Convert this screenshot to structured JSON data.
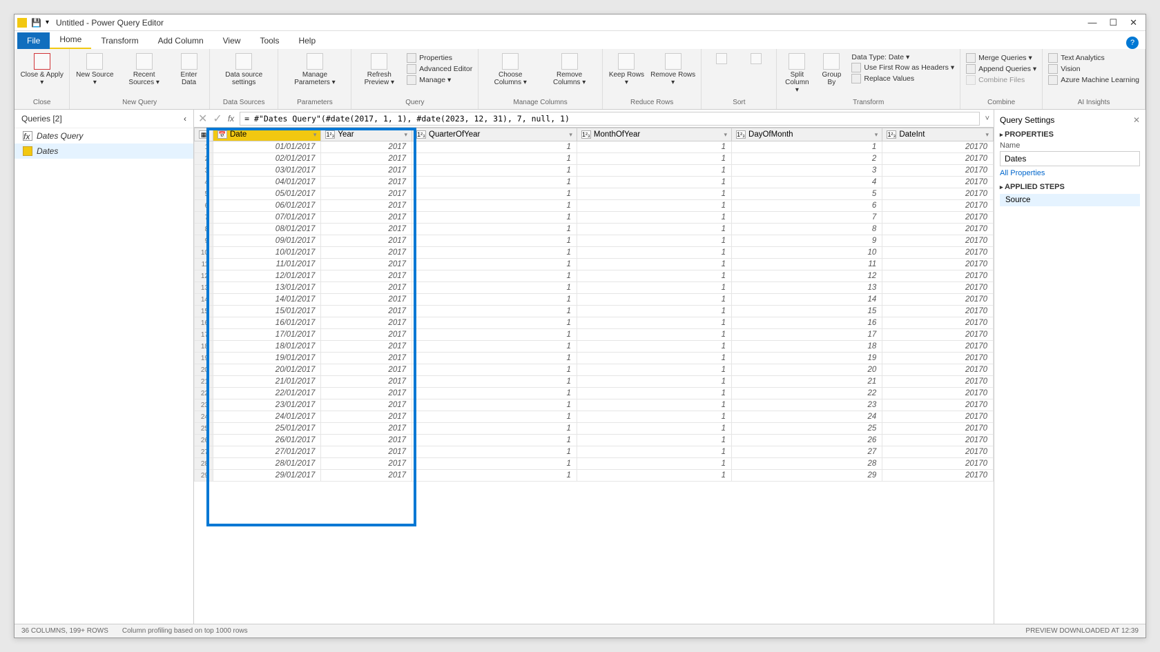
{
  "window": {
    "title": "Untitled - Power Query Editor"
  },
  "menubar": {
    "file": "File",
    "home": "Home",
    "transform": "Transform",
    "addcol": "Add Column",
    "view": "View",
    "tools": "Tools",
    "help": "Help"
  },
  "ribbon": {
    "close": {
      "closeApply": "Close &\nApply ▾",
      "group": "Close"
    },
    "newquery": {
      "newSource": "New\nSource ▾",
      "recentSources": "Recent\nSources ▾",
      "enterData": "Enter\nData",
      "group": "New Query"
    },
    "datasources": {
      "dsSettings": "Data source\nsettings",
      "group": "Data Sources"
    },
    "parameters": {
      "manage": "Manage\nParameters ▾",
      "group": "Parameters"
    },
    "query": {
      "refresh": "Refresh\nPreview ▾",
      "properties": "Properties",
      "advEditor": "Advanced Editor",
      "manage": "Manage ▾",
      "group": "Query"
    },
    "managecols": {
      "choose": "Choose\nColumns ▾",
      "remove": "Remove\nColumns ▾",
      "group": "Manage Columns"
    },
    "reducerows": {
      "keep": "Keep\nRows ▾",
      "removeR": "Remove\nRows ▾",
      "group": "Reduce Rows"
    },
    "sort": {
      "group": "Sort"
    },
    "transform": {
      "split": "Split\nColumn ▾",
      "groupby": "Group\nBy",
      "datatype": "Data Type: Date ▾",
      "firstrow": "Use First Row as Headers ▾",
      "replace": "Replace Values",
      "group": "Transform"
    },
    "combine": {
      "merge": "Merge Queries ▾",
      "append": "Append Queries ▾",
      "combinefiles": "Combine Files",
      "group": "Combine"
    },
    "ai": {
      "textan": "Text Analytics",
      "vision": "Vision",
      "azml": "Azure Machine Learning",
      "group": "AI Insights"
    }
  },
  "queries": {
    "header": "Queries [2]",
    "items": [
      "Dates Query",
      "Dates"
    ]
  },
  "formula": "= #\"Dates Query\"(#date(2017, 1, 1), #date(2023, 12, 31), 7, null, 1)",
  "columns": [
    "Date",
    "Year",
    "QuarterOfYear",
    "MonthOfYear",
    "DayOfMonth",
    "DateInt"
  ],
  "rows": [
    {
      "n": 1,
      "date": "01/01/2017",
      "year": 2017,
      "q": 1,
      "m": 1,
      "d": 1,
      "di": "20170"
    },
    {
      "n": 2,
      "date": "02/01/2017",
      "year": 2017,
      "q": 1,
      "m": 1,
      "d": 2,
      "di": "20170"
    },
    {
      "n": 3,
      "date": "03/01/2017",
      "year": 2017,
      "q": 1,
      "m": 1,
      "d": 3,
      "di": "20170"
    },
    {
      "n": 4,
      "date": "04/01/2017",
      "year": 2017,
      "q": 1,
      "m": 1,
      "d": 4,
      "di": "20170"
    },
    {
      "n": 5,
      "date": "05/01/2017",
      "year": 2017,
      "q": 1,
      "m": 1,
      "d": 5,
      "di": "20170"
    },
    {
      "n": 6,
      "date": "06/01/2017",
      "year": 2017,
      "q": 1,
      "m": 1,
      "d": 6,
      "di": "20170"
    },
    {
      "n": 7,
      "date": "07/01/2017",
      "year": 2017,
      "q": 1,
      "m": 1,
      "d": 7,
      "di": "20170"
    },
    {
      "n": 8,
      "date": "08/01/2017",
      "year": 2017,
      "q": 1,
      "m": 1,
      "d": 8,
      "di": "20170"
    },
    {
      "n": 9,
      "date": "09/01/2017",
      "year": 2017,
      "q": 1,
      "m": 1,
      "d": 9,
      "di": "20170"
    },
    {
      "n": 10,
      "date": "10/01/2017",
      "year": 2017,
      "q": 1,
      "m": 1,
      "d": 10,
      "di": "20170"
    },
    {
      "n": 11,
      "date": "11/01/2017",
      "year": 2017,
      "q": 1,
      "m": 1,
      "d": 11,
      "di": "20170"
    },
    {
      "n": 12,
      "date": "12/01/2017",
      "year": 2017,
      "q": 1,
      "m": 1,
      "d": 12,
      "di": "20170"
    },
    {
      "n": 13,
      "date": "13/01/2017",
      "year": 2017,
      "q": 1,
      "m": 1,
      "d": 13,
      "di": "20170"
    },
    {
      "n": 14,
      "date": "14/01/2017",
      "year": 2017,
      "q": 1,
      "m": 1,
      "d": 14,
      "di": "20170"
    },
    {
      "n": 15,
      "date": "15/01/2017",
      "year": 2017,
      "q": 1,
      "m": 1,
      "d": 15,
      "di": "20170"
    },
    {
      "n": 16,
      "date": "16/01/2017",
      "year": 2017,
      "q": 1,
      "m": 1,
      "d": 16,
      "di": "20170"
    },
    {
      "n": 17,
      "date": "17/01/2017",
      "year": 2017,
      "q": 1,
      "m": 1,
      "d": 17,
      "di": "20170"
    },
    {
      "n": 18,
      "date": "18/01/2017",
      "year": 2017,
      "q": 1,
      "m": 1,
      "d": 18,
      "di": "20170"
    },
    {
      "n": 19,
      "date": "19/01/2017",
      "year": 2017,
      "q": 1,
      "m": 1,
      "d": 19,
      "di": "20170"
    },
    {
      "n": 20,
      "date": "20/01/2017",
      "year": 2017,
      "q": 1,
      "m": 1,
      "d": 20,
      "di": "20170"
    },
    {
      "n": 21,
      "date": "21/01/2017",
      "year": 2017,
      "q": 1,
      "m": 1,
      "d": 21,
      "di": "20170"
    },
    {
      "n": 22,
      "date": "22/01/2017",
      "year": 2017,
      "q": 1,
      "m": 1,
      "d": 22,
      "di": "20170"
    },
    {
      "n": 23,
      "date": "23/01/2017",
      "year": 2017,
      "q": 1,
      "m": 1,
      "d": 23,
      "di": "20170"
    },
    {
      "n": 24,
      "date": "24/01/2017",
      "year": 2017,
      "q": 1,
      "m": 1,
      "d": 24,
      "di": "20170"
    },
    {
      "n": 25,
      "date": "25/01/2017",
      "year": 2017,
      "q": 1,
      "m": 1,
      "d": 25,
      "di": "20170"
    },
    {
      "n": 26,
      "date": "26/01/2017",
      "year": 2017,
      "q": 1,
      "m": 1,
      "d": 26,
      "di": "20170"
    },
    {
      "n": 27,
      "date": "27/01/2017",
      "year": 2017,
      "q": 1,
      "m": 1,
      "d": 27,
      "di": "20170"
    },
    {
      "n": 28,
      "date": "28/01/2017",
      "year": 2017,
      "q": 1,
      "m": 1,
      "d": 28,
      "di": "20170"
    },
    {
      "n": 29,
      "date": "29/01/2017",
      "year": 2017,
      "q": 1,
      "m": 1,
      "d": 29,
      "di": "20170"
    }
  ],
  "settings": {
    "title": "Query Settings",
    "propsHead": "PROPERTIES",
    "nameLabel": "Name",
    "nameValue": "Dates",
    "allProps": "All Properties",
    "stepsHead": "APPLIED STEPS",
    "step1": "Source"
  },
  "status": {
    "left": "36 COLUMNS, 199+ ROWS",
    "mid": "Column profiling based on top 1000 rows",
    "right": "PREVIEW DOWNLOADED AT 12:39"
  }
}
